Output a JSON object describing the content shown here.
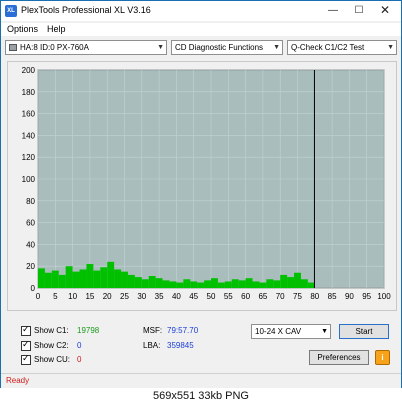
{
  "window": {
    "title": "PlexTools Professional XL V3.16",
    "icon_text": "XL"
  },
  "menu": {
    "items": [
      "Options",
      "Help"
    ]
  },
  "toolbar": {
    "drive": "HA:8 ID:0  PX-760A",
    "function": "CD Diagnostic Functions",
    "test": "Q-Check C1/C2 Test"
  },
  "chart_data": {
    "type": "bar",
    "title": "",
    "xlabel": "",
    "ylabel": "",
    "xlim": [
      0,
      100
    ],
    "ylim": [
      0,
      200
    ],
    "x_ticks": [
      0,
      5,
      10,
      15,
      20,
      25,
      30,
      35,
      40,
      45,
      50,
      55,
      60,
      65,
      70,
      75,
      80,
      85,
      90,
      95,
      100
    ],
    "y_ticks": [
      0,
      20,
      40,
      60,
      80,
      100,
      120,
      140,
      160,
      180,
      200
    ],
    "end_marker_x": 79.9,
    "series": [
      {
        "color": "#00c000",
        "x": [
          0,
          2,
          4,
          6,
          8,
          10,
          12,
          14,
          16,
          18,
          20,
          22,
          24,
          26,
          28,
          30,
          32,
          34,
          36,
          38,
          40,
          42,
          44,
          46,
          48,
          50,
          52,
          54,
          56,
          58,
          60,
          62,
          64,
          66,
          68,
          70,
          72,
          74,
          76,
          78
        ],
        "values": [
          18,
          14,
          16,
          12,
          20,
          15,
          17,
          22,
          16,
          19,
          24,
          17,
          15,
          12,
          10,
          8,
          11,
          9,
          7,
          6,
          5,
          8,
          6,
          5,
          7,
          9,
          5,
          6,
          8,
          7,
          9,
          6,
          5,
          8,
          7,
          12,
          10,
          14,
          8,
          5
        ]
      }
    ]
  },
  "stats": {
    "c1_label": "Show C1:",
    "c1_value": "19798",
    "c2_label": "Show C2:",
    "c2_value": "0",
    "cu_label": "Show CU:",
    "cu_value": "0",
    "msf_label": "MSF:",
    "msf_value": "79:57.70",
    "lba_label": "LBA:",
    "lba_value": "359845"
  },
  "controls": {
    "speed": "10-24 X CAV",
    "start": "Start",
    "preferences": "Preferences",
    "info": "i"
  },
  "status": {
    "text": "Ready"
  },
  "caption": "569x551  33kb  PNG"
}
